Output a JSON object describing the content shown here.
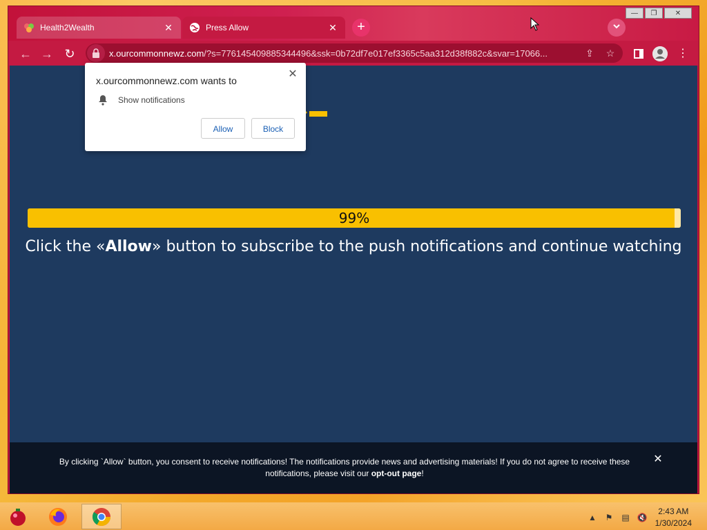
{
  "browser": {
    "tabs": [
      {
        "title": "Health2Wealth",
        "active": false
      },
      {
        "title": "Press Allow",
        "active": true
      }
    ],
    "url_host": "x.ourcommonnewz.com",
    "url_rest": "/?s=776145409885344496&ssk=0b72df7e017ef3365c5aa312d38f882c&svar=17066...",
    "window_controls": {
      "minimize": "—",
      "restore": "❐",
      "close": "✕"
    },
    "new_tab": "+",
    "tab_menu": "⌄"
  },
  "permission_prompt": {
    "title": "x.ourcommonnewz.com wants to",
    "permission": "Show notifications",
    "allow_label": "Allow",
    "block_label": "Block",
    "close": "✕"
  },
  "page": {
    "progress_label": "99%",
    "progress_value": 0.99,
    "headline_before": "Click the «",
    "headline_bold": "Allow",
    "headline_after": "» button to subscribe to the push notifications and continue watching",
    "consent_text": "By clicking `Allow` button, you consent to receive notifications! The notifications provide news and advertising materials! If you do not agree to receive these notifications, please visit our",
    "consent_link": "opt-out page",
    "consent_end": "!",
    "consent_close": "✕"
  },
  "taskbar": {
    "time": "2:43 AM",
    "date": "1/30/2024"
  },
  "colors": {
    "browser_chrome": "#c41a42",
    "page_bg": "#1e3a5f",
    "progress": "#f9c000",
    "consent_bg": "#0c1524",
    "desktop": "#f5b83a"
  }
}
